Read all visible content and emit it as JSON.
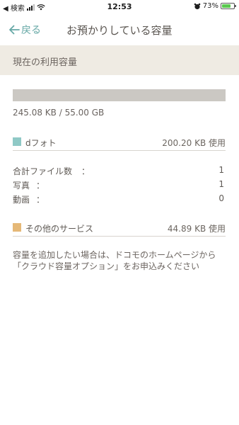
{
  "status_bar": {
    "carrier": "◀ 検索",
    "time": "12:53",
    "battery_percent": "73%",
    "battery_level": 0.73,
    "icons": [
      "signal-icon",
      "wifi-icon",
      "alarm-icon",
      "battery-icon"
    ]
  },
  "nav": {
    "back_label": "戻る",
    "title": "お預かりしている容量"
  },
  "usage": {
    "section_title": "現在の利用容量",
    "fraction_used": 0.0,
    "summary": "245.08 KB / 55.00 GB"
  },
  "services": [
    {
      "name": "dフォト",
      "value": "200.20 KB 使用",
      "color": "#8fc9c6"
    },
    {
      "name": "その他のサービス",
      "value": "44.89 KB 使用",
      "color": "#e5b877"
    }
  ],
  "file_counts": [
    {
      "label": "合計ファイル数",
      "colon": "：",
      "value": "1"
    },
    {
      "label": "写真",
      "colon": "：",
      "value": "1"
    },
    {
      "label": "動画",
      "colon": "：",
      "value": "0"
    }
  ],
  "note": {
    "line1": "容量を追加したい場合は、ドコモのホームページから",
    "line2": "「クラウド容量オプション」をお申込みください"
  },
  "colors": {
    "accent": "#66a8a6",
    "section_bg": "#efebe3",
    "bar_bg": "#cbc8c3"
  }
}
